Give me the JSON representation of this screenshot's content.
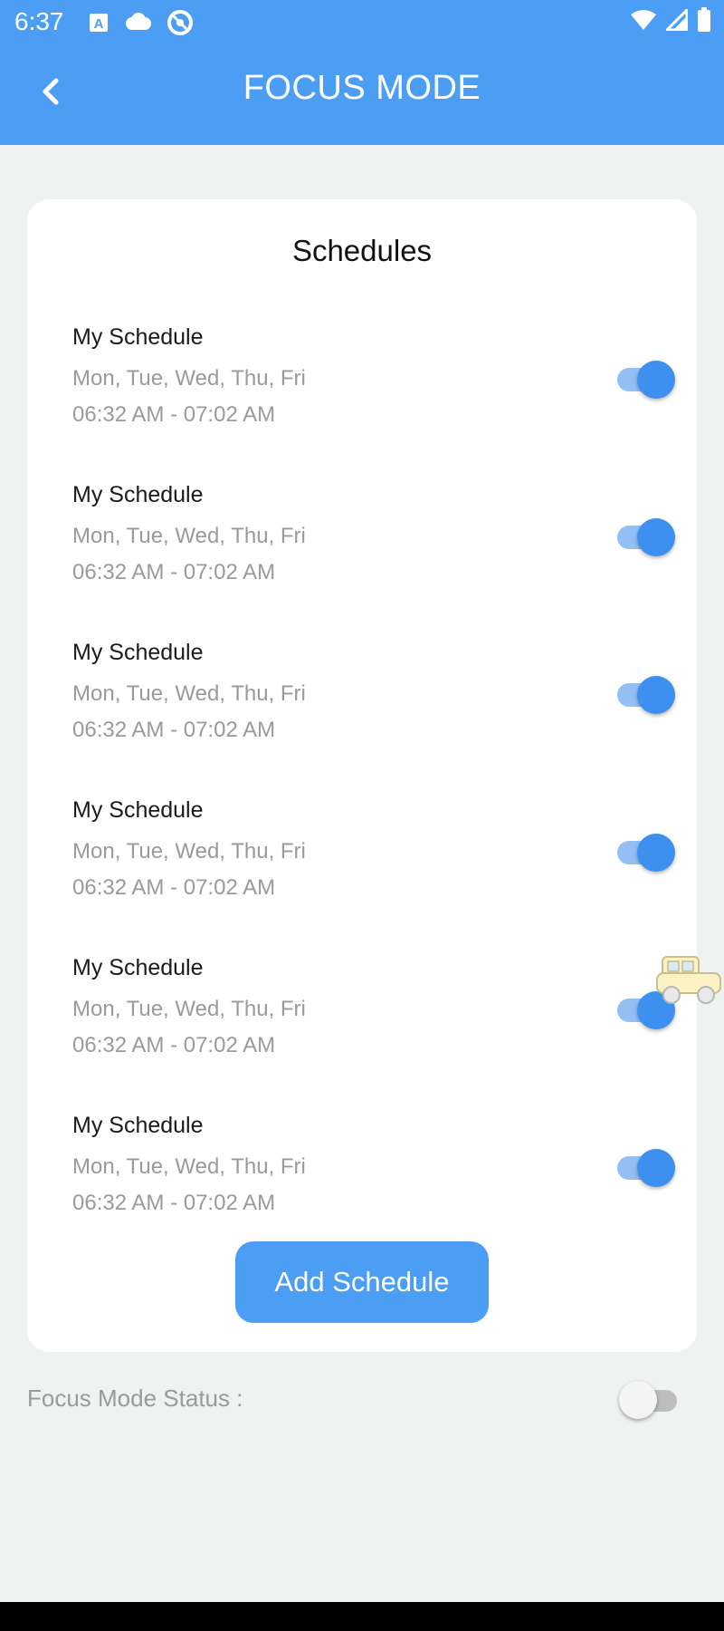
{
  "status_bar": {
    "time": "6:37",
    "left_icons": [
      "a-app-icon",
      "cloud-icon",
      "at-sign-icon"
    ],
    "right_icons": [
      "wifi-icon",
      "signal-icon",
      "battery-icon"
    ]
  },
  "header": {
    "title": "FOCUS MODE",
    "back_icon": "chevron-left-icon",
    "color": "#4c9ef5"
  },
  "schedules": {
    "title": "Schedules",
    "items": [
      {
        "name": "My Schedule",
        "days": "Mon, Tue, Wed, Thu, Fri",
        "time": "06:32 AM - 07:02 AM",
        "enabled": true
      },
      {
        "name": "My Schedule",
        "days": "Mon, Tue, Wed, Thu, Fri",
        "time": "06:32 AM - 07:02 AM",
        "enabled": true
      },
      {
        "name": "My Schedule",
        "days": "Mon, Tue, Wed, Thu, Fri",
        "time": "06:32 AM - 07:02 AM",
        "enabled": true
      },
      {
        "name": "My Schedule",
        "days": "Mon, Tue, Wed, Thu, Fri",
        "time": "06:32 AM - 07:02 AM",
        "enabled": true
      },
      {
        "name": "My Schedule",
        "days": "Mon, Tue, Wed, Thu, Fri",
        "time": "06:32 AM - 07:02 AM",
        "enabled": true
      },
      {
        "name": "My Schedule",
        "days": "Mon, Tue, Wed, Thu, Fri",
        "time": "06:32 AM - 07:02 AM",
        "enabled": true
      }
    ],
    "add_button_label": "Add Schedule"
  },
  "focus_mode_status": {
    "label": "Focus Mode Status :",
    "enabled": false
  },
  "colors": {
    "accent": "#4c9ef5",
    "toggle_on": "#3d8ff0",
    "background": "#eef3f2"
  }
}
